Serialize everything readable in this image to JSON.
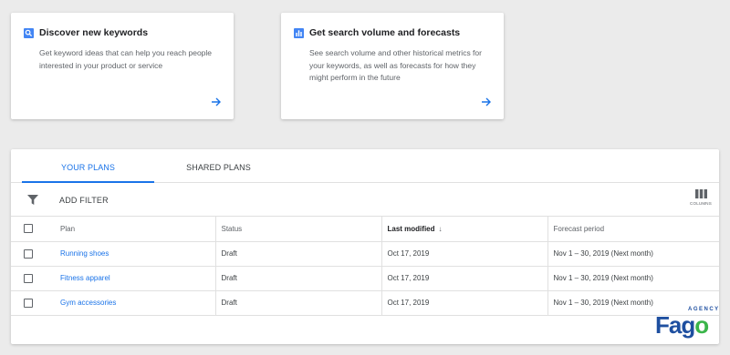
{
  "cards": [
    {
      "title": "Discover new keywords",
      "description": "Get keyword ideas that can help you reach people interested in your product or service",
      "icon": "search-icon"
    },
    {
      "title": "Get search volume and forecasts",
      "description": "See search volume and other historical metrics for your keywords, as well as forecasts for how they might perform in the future",
      "icon": "bar-chart-icon"
    }
  ],
  "tabs": [
    "YOUR PLANS",
    "SHARED PLANS"
  ],
  "active_tab": "YOUR PLANS",
  "toolbar": {
    "add_filter": "ADD FILTER",
    "columns_label": "COLUMNS"
  },
  "table": {
    "headers": [
      "Plan",
      "Status",
      "Last modified",
      "Forecast period"
    ],
    "sorted_column": "Last modified",
    "rows": [
      {
        "plan": "Running shoes",
        "status": "Draft",
        "last_modified": "Oct 17, 2019",
        "forecast": "Nov 1 – 30, 2019 (Next month)"
      },
      {
        "plan": "Fitness apparel",
        "status": "Draft",
        "last_modified": "Oct 17, 2019",
        "forecast": "Nov 1 – 30, 2019 (Next month)"
      },
      {
        "plan": "Gym accessories",
        "status": "Draft",
        "last_modified": "Oct 17, 2019",
        "forecast": "Nov 1 – 30, 2019 (Next month)"
      }
    ]
  },
  "logo": {
    "word": "Fago",
    "agency": "AGENCY"
  },
  "colors": {
    "accent": "#1a73e8",
    "card_icon": "#4285f4",
    "logo_blue": "#1e4fa0",
    "logo_green": "#3bb54a"
  }
}
